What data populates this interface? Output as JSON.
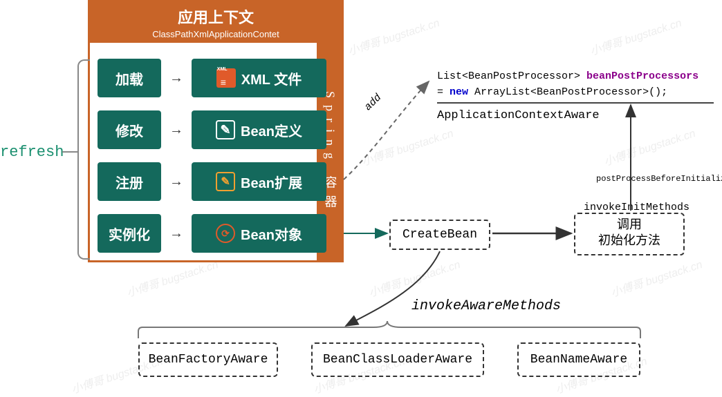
{
  "header": {
    "title": "应用上下文",
    "subtitle": "ClassPathXmlApplicationContet"
  },
  "spring_label": "Spring 容器",
  "refresh_label": "refresh",
  "steps": [
    {
      "action": "加载",
      "icon": "xml",
      "target": "XML 文件"
    },
    {
      "action": "修改",
      "icon": "edit",
      "target": "Bean定义"
    },
    {
      "action": "注册",
      "icon": "ext",
      "target": "Bean扩展"
    },
    {
      "action": "实例化",
      "icon": "inst",
      "target": "Bean对象"
    }
  ],
  "code": {
    "line1_a": "List<BeanPostProcessor> ",
    "line1_b": "beanPostProcessors",
    "line2_a": "= ",
    "line2_kw": "new",
    "line2_b": " ArrayList<BeanPostProcessor>();"
  },
  "aca_label": "ApplicationContextAware",
  "create_bean": "CreateBean",
  "init": {
    "l1": "调用",
    "l2": "初始化方法"
  },
  "awares": {
    "bfa": "BeanFactoryAware",
    "bcla": "BeanClassLoaderAware",
    "bna": "BeanNameAware"
  },
  "labels": {
    "add": "add",
    "ppbi": "postProcessBeforeInitialization",
    "iim": "invokeInitMethods",
    "iam": "invokeAwareMethods"
  }
}
